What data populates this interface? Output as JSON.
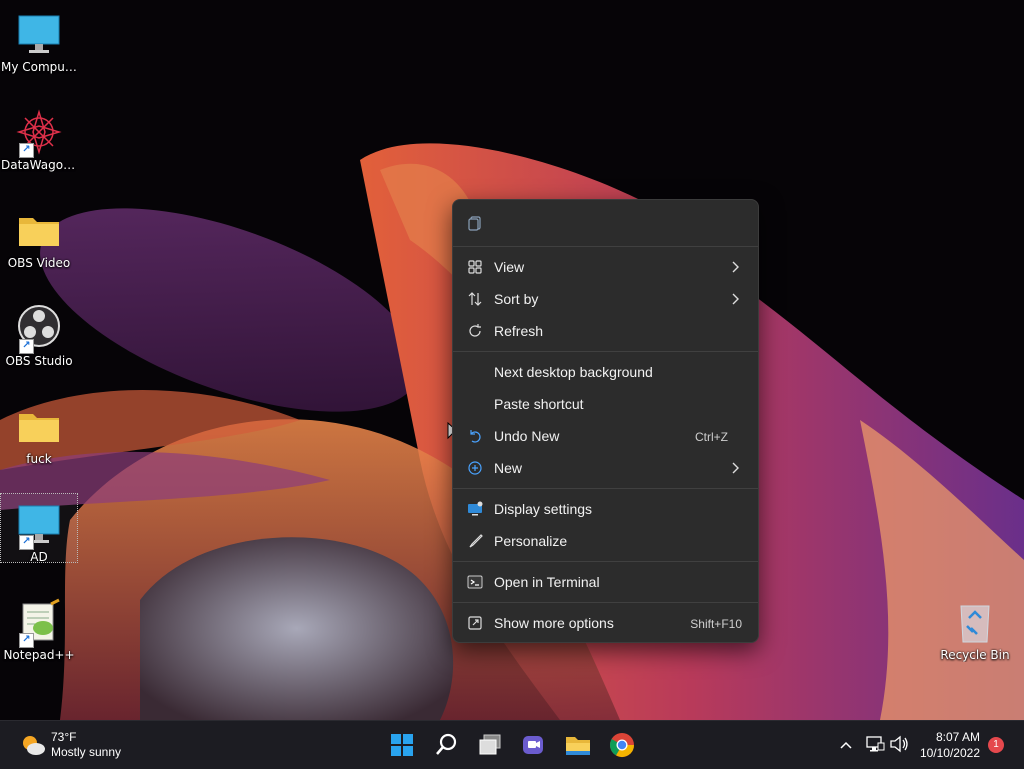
{
  "desktop": {
    "icons": [
      {
        "label": "My Computer",
        "icon": "monitor-icon"
      },
      {
        "label": "DataWagon...",
        "icon": "datawagon-logo-icon"
      },
      {
        "label": "OBS Video",
        "icon": "folder-icon"
      },
      {
        "label": "OBS Studio",
        "icon": "obs-logo-icon"
      },
      {
        "label": "fuck",
        "icon": "folder-icon"
      },
      {
        "label": "AD",
        "icon": "monitor-icon"
      },
      {
        "label": "Notepad++",
        "icon": "notepad-plus-plus-icon"
      }
    ],
    "recycle_bin": {
      "label": "Recycle Bin",
      "icon": "recycle-bin-icon"
    }
  },
  "context_menu": {
    "top_action_icon": "copy-icon",
    "items": [
      {
        "label": "View",
        "icon": "grid-icon",
        "submenu": true
      },
      {
        "label": "Sort by",
        "icon": "sort-icon",
        "submenu": true
      },
      {
        "label": "Refresh",
        "icon": "refresh-icon"
      },
      {
        "label": "Next desktop background"
      },
      {
        "label": "Paste shortcut"
      },
      {
        "label": "Undo New",
        "icon": "undo-icon",
        "shortcut": "Ctrl+Z"
      },
      {
        "label": "New",
        "icon": "plus-circle-icon",
        "submenu": true
      },
      {
        "label": "Display settings",
        "icon": "display-icon"
      },
      {
        "label": "Personalize",
        "icon": "brush-icon"
      },
      {
        "label": "Open in Terminal",
        "icon": "terminal-icon"
      },
      {
        "label": "Show more options",
        "icon": "expand-icon",
        "shortcut": "Shift+F10"
      }
    ]
  },
  "taskbar": {
    "weather": {
      "temp": "73°F",
      "condition": "Mostly sunny"
    },
    "apps": [
      "start-icon",
      "search-icon",
      "task-view-icon",
      "chat-icon",
      "file-explorer-icon",
      "chrome-icon"
    ],
    "tray": [
      "chevron-up-icon",
      "network-icon",
      "volume-icon"
    ],
    "clock": {
      "time": "8:07 AM",
      "date": "10/10/2022"
    },
    "notification_count": "1"
  },
  "colors": {
    "menu_bg": "#2c2c2c",
    "taskbar_bg": "#1c1c22",
    "accent": "#0a84ff"
  }
}
